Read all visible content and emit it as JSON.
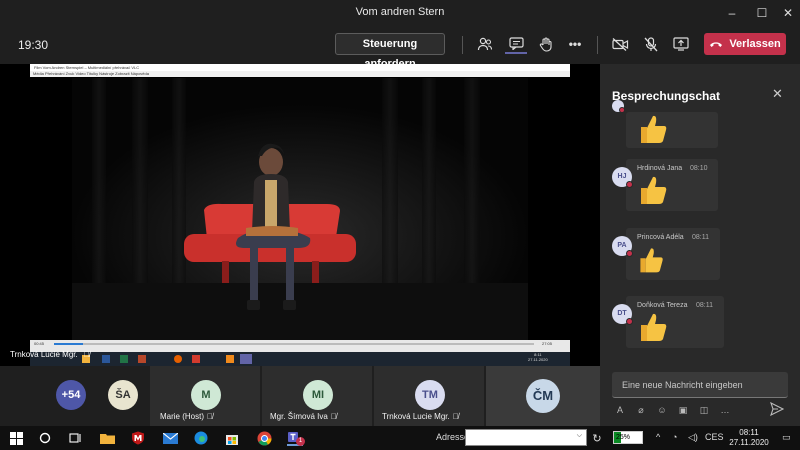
{
  "window": {
    "title": "Vom andren Stern"
  },
  "toolbar": {
    "timer": "19:30",
    "control_label": "Steuerung anfordern",
    "leave_label": "Verlassen",
    "more_label": "•••"
  },
  "shared_window": {
    "vlc_title": "Film Vom Andren Sternspiel – Multimediální přehrávač VLC",
    "vlc_menu": "Média  Přehrávání  Zvuk  Video  Titulky  Nástroje  Zobrazit  Nápověda",
    "time_start": "00:45",
    "time_end": "27:05",
    "inner_clock_time": "8:11",
    "inner_clock_date": "27.11.2020",
    "presenter_name": "Trnková Lucie Mgr."
  },
  "chat": {
    "header": "Besprechungschat",
    "messages": [
      {
        "initials": "",
        "name": "",
        "time": "",
        "reaction": "thumbs-up"
      },
      {
        "initials": "HJ",
        "name": "Hrdinová Jana",
        "time": "08:10",
        "reaction": "thumbs-up"
      },
      {
        "initials": "PA",
        "name": "Princová Adéla",
        "time": "08:11",
        "reaction": "thumbs-up"
      },
      {
        "initials": "DT",
        "name": "Doňková Tereza",
        "time": "08:11",
        "reaction": "thumbs-up"
      }
    ],
    "input_placeholder": "Eine neue Nachricht eingeben"
  },
  "gallery": {
    "overflow_count": "+54",
    "tiles": [
      {
        "initials": "ŠA",
        "name": ""
      },
      {
        "initials": "M",
        "name": "Marie (Host)"
      },
      {
        "initials": "MI",
        "name": "Mgr. Šímová Iva"
      },
      {
        "initials": "TM",
        "name": "Trnková Lucie Mgr."
      },
      {
        "initials": "ČM",
        "name": ""
      }
    ]
  },
  "taskbar": {
    "address_label": "Adresse",
    "teams_badge": "1",
    "battery_percent": 25,
    "battery_label": "25%",
    "language": "CES",
    "clock_time": "08:11",
    "clock_date": "27.11.2020"
  },
  "colors": {
    "leave": "#c4314b",
    "presence": "#c4314b",
    "thumb": "#f6c343",
    "accent": "#6264a7"
  }
}
